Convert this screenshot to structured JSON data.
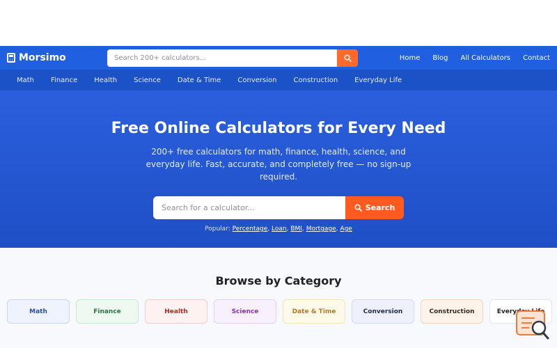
{
  "header": {
    "logo": "Morsimo",
    "search_placeholder": "Search 200+ calculators...",
    "nav": [
      "Home",
      "Blog",
      "All Calculators",
      "Contact"
    ]
  },
  "category_nav": [
    "Math",
    "Finance",
    "Health",
    "Science",
    "Date & Time",
    "Conversion",
    "Construction",
    "Everyday Life"
  ],
  "hero": {
    "title": "Free Online Calculators for Every Need",
    "subtitle": "200+ free calculators for math, finance, health, science, and everyday life. Fast, accurate, and completely free — no sign-up required.",
    "search_placeholder": "Search for a calculator...",
    "search_button": "Search",
    "popular_label": "Popular:",
    "popular_links": [
      "Percentage",
      "Loan",
      "BMI",
      "Mortgage",
      "Age"
    ]
  },
  "browse": {
    "title": "Browse by Category",
    "cards": [
      {
        "label": "Math",
        "color": "#2a4bb8",
        "bg": "#eef3fd",
        "border": "#c9d6f4"
      },
      {
        "label": "Finance",
        "color": "#1f7a3c",
        "bg": "#eefaf1",
        "border": "#c8ecd2"
      },
      {
        "label": "Health",
        "color": "#c02525",
        "bg": "#fdf1f1",
        "border": "#f1cdcd"
      },
      {
        "label": "Science",
        "color": "#8a2fc4",
        "bg": "#f8f1fd",
        "border": "#e4cff4"
      },
      {
        "label": "Date & Time",
        "color": "#b7791f",
        "bg": "#fefaea",
        "border": "#f3e5b8"
      },
      {
        "label": "Conversion",
        "color": "#1e2a4a",
        "bg": "#eef1fb",
        "border": "#d3dbf2"
      },
      {
        "label": "Construction",
        "color": "#3a2a1a",
        "bg": "#fdf3ea",
        "border": "#f2d8c0"
      },
      {
        "label": "Everyday Life",
        "color": "#222222",
        "bg": "#ffffff",
        "border": "#e3e6ea"
      }
    ]
  },
  "colors": {
    "primary": "#1f5fe0",
    "accent": "#ff5a1f"
  }
}
